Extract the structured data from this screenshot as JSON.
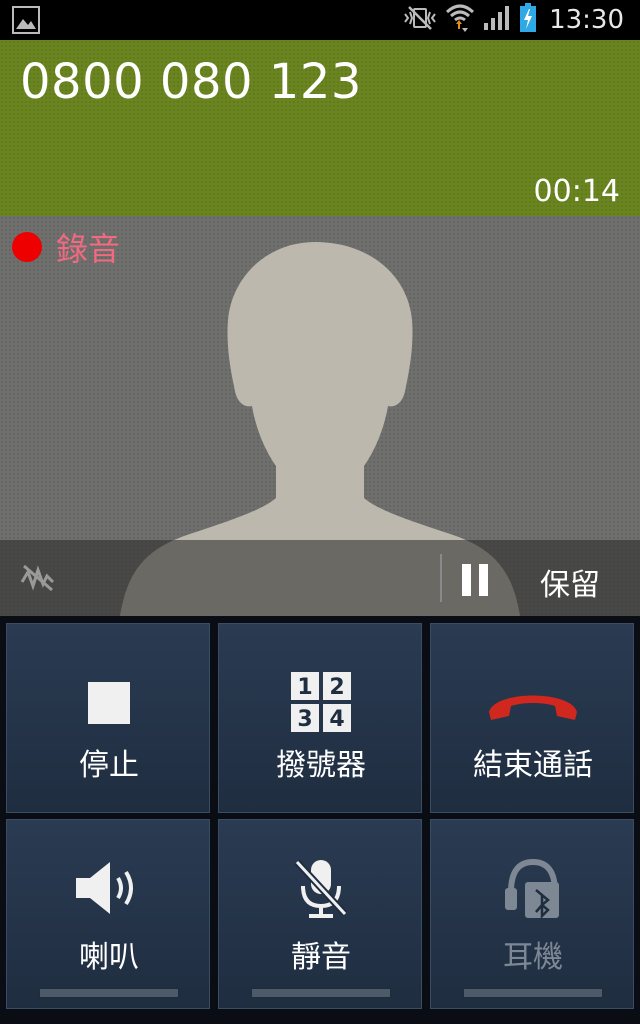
{
  "status_bar": {
    "time": "13:30",
    "icons": [
      "gallery-notification-icon",
      "vibrate-mute-icon",
      "wifi-icon",
      "signal-icon",
      "battery-charging-icon"
    ]
  },
  "call": {
    "number": "0800 080 123",
    "duration": "00:14",
    "header_color": "#6a8520"
  },
  "recording": {
    "label": "錄音",
    "dot_color": "#ee0000"
  },
  "hold_bar": {
    "noise_icon": "noise-reduction-off-icon",
    "hold_label": "保留",
    "hold_icon": "pause-icon"
  },
  "buttons": [
    {
      "label": "停止",
      "icon": "stop-icon",
      "enabled": true
    },
    {
      "label": "撥號器",
      "icon": "dialpad-icon",
      "enabled": true
    },
    {
      "label": "結束通話",
      "icon": "end-call-icon",
      "enabled": true,
      "accent": "#d0281e"
    },
    {
      "label": "喇叭",
      "icon": "speaker-icon",
      "enabled": true
    },
    {
      "label": "靜音",
      "icon": "mute-mic-icon",
      "enabled": true
    },
    {
      "label": "耳機",
      "icon": "bluetooth-headset-icon",
      "enabled": false
    }
  ],
  "dialpad_keys": [
    "1",
    "2",
    "3",
    "4"
  ]
}
